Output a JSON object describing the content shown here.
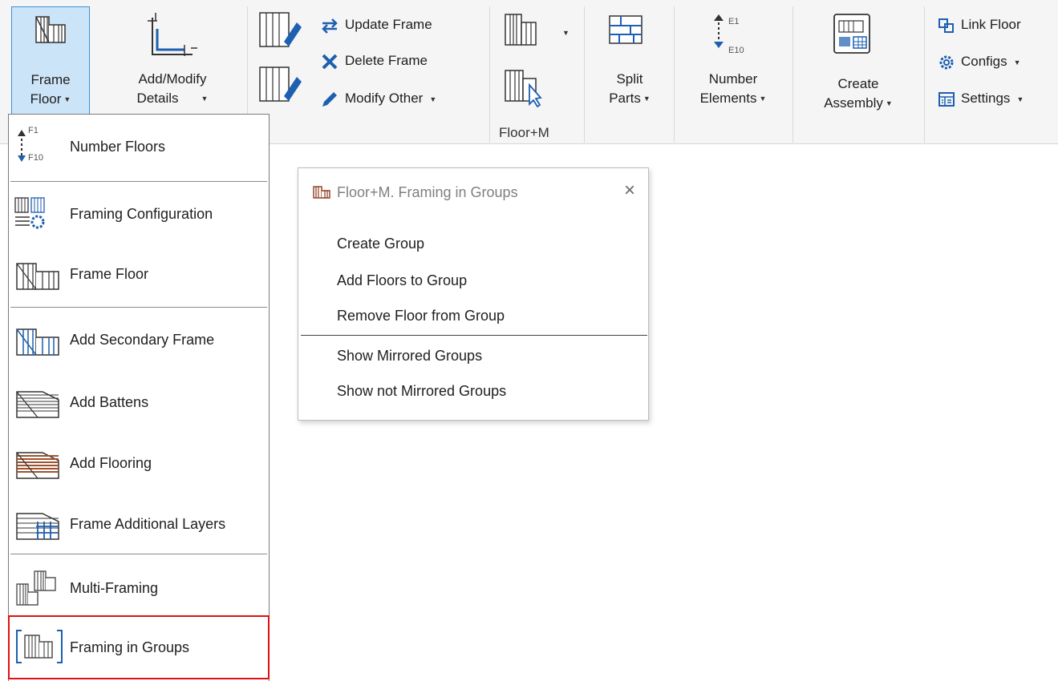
{
  "ribbon": {
    "frame_floor": "Frame Floor",
    "frame_floor_line1": "Frame",
    "frame_floor_line2": "Floor",
    "add_modify_line1": "Add/Modify",
    "add_modify_line2": "Details",
    "update_frame": "Update Frame",
    "delete_frame": "Delete Frame",
    "modify_other": "Modify Other",
    "split_line1": "Split",
    "split_line2": "Parts",
    "number_line1": "Number",
    "number_line2": "Elements",
    "create_line1": "Create",
    "create_line2": "Assembly",
    "link_floor": "Link Floor",
    "configs": "Configs",
    "settings": "Settings",
    "panel_label": "Floor+M",
    "num_badge_top": "E1",
    "num_badge_bottom": "E10"
  },
  "menu": {
    "items": [
      {
        "label": "Number Floors",
        "badge_top": "F1",
        "badge_bottom": "F10"
      },
      {
        "label": "Framing Configuration"
      },
      {
        "label": "Frame Floor"
      },
      {
        "label": "Add Secondary Frame"
      },
      {
        "label": "Add Battens"
      },
      {
        "label": "Add Flooring"
      },
      {
        "label": "Frame Additional Layers"
      },
      {
        "label": "Multi-Framing"
      },
      {
        "label": "Framing in Groups"
      }
    ]
  },
  "popup": {
    "title": "Floor+M. Framing in Groups",
    "close": "×",
    "items": [
      "Create Group",
      "Add Floors to Group",
      "Remove Floor from Group",
      "Show Mirrored Groups",
      "Show not Mirrored Groups"
    ]
  },
  "colors": {
    "accent": "#3c8fd6",
    "active_bg": "#cce4f7",
    "highlight": "#e01010",
    "icon_blue": "#1d5fb0",
    "flooring": "#a0522d"
  }
}
